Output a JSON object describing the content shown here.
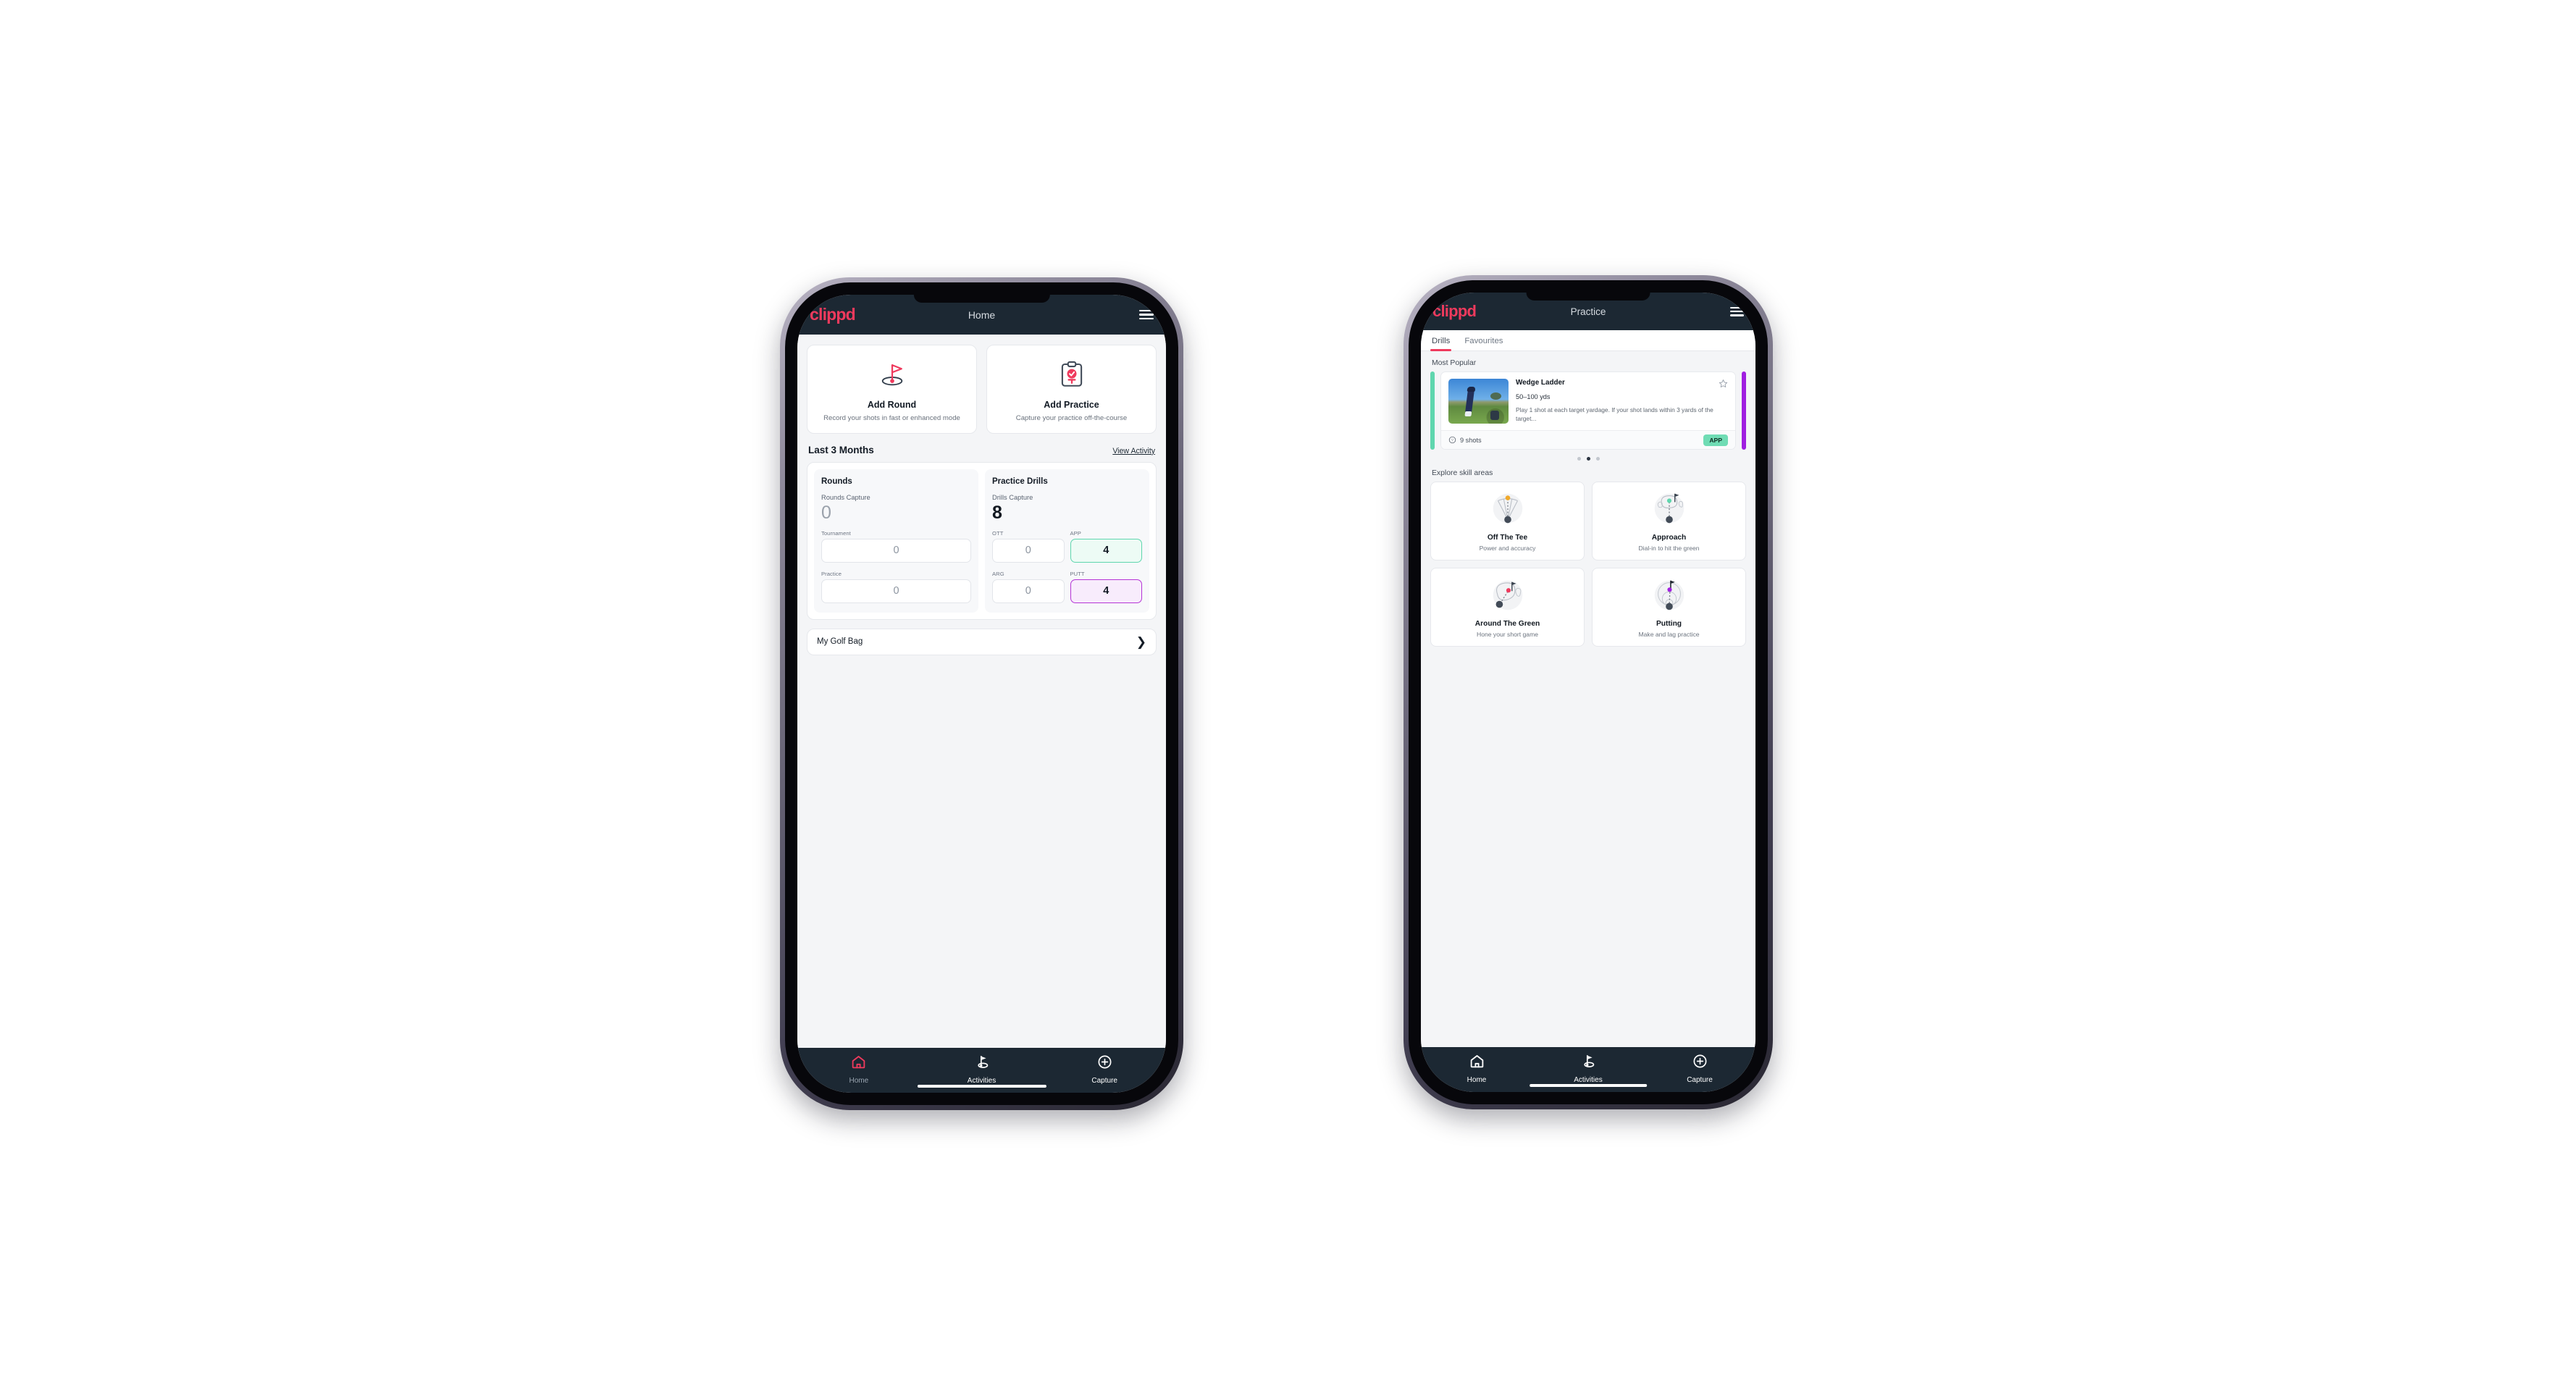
{
  "brand": {
    "logo_text": "clippd",
    "accent_pink": "#ef3a5d",
    "appbar_bg": "#1c2833",
    "mint": "#5fd6ae",
    "violet": "#a01fe0"
  },
  "home": {
    "appbar": {
      "title": "Home",
      "menu_icon": "hamburger-icon"
    },
    "quick_actions": [
      {
        "icon": "golf-flag-hole-icon",
        "title": "Add Round",
        "subtitle": "Record your shots in fast or enhanced mode"
      },
      {
        "icon": "clipboard-check-tee-icon",
        "title": "Add Practice",
        "subtitle": "Capture your practice off-the-course"
      }
    ],
    "section": {
      "title": "Last 3 Months",
      "link": "View Activity"
    },
    "rounds": {
      "heading": "Rounds",
      "capture_label": "Rounds Capture",
      "capture_value": "0",
      "items": [
        {
          "label": "Tournament",
          "value": "0",
          "state": "empty"
        },
        {
          "label": "Practice",
          "value": "0",
          "state": "empty"
        }
      ]
    },
    "drills": {
      "heading": "Practice Drills",
      "capture_label": "Drills Capture",
      "capture_value": "8",
      "items": [
        {
          "label": "OTT",
          "value": "0",
          "state": "empty"
        },
        {
          "label": "APP",
          "value": "4",
          "state": "app"
        },
        {
          "label": "ARG",
          "value": "0",
          "state": "empty"
        },
        {
          "label": "PUTT",
          "value": "4",
          "state": "putt"
        }
      ]
    },
    "golf_bag": {
      "label": "My Golf Bag",
      "chevron": "chevron-right-icon"
    },
    "bottom_nav": [
      {
        "label": "Home",
        "icon": "home-icon",
        "active": true
      },
      {
        "label": "Activities",
        "icon": "golf-flag-icon",
        "active": false
      },
      {
        "label": "Capture",
        "icon": "plus-circle-icon",
        "active": false
      }
    ]
  },
  "practice": {
    "appbar": {
      "title": "Practice",
      "menu_icon": "hamburger-icon"
    },
    "tabs": [
      {
        "label": "Drills",
        "active": true
      },
      {
        "label": "Favourites",
        "active": false
      }
    ],
    "most_popular_label": "Most Popular",
    "featured_drill": {
      "name": "Wedge Ladder",
      "yardage": "50–100 yds",
      "description": "Play 1 shot at each target yardage. If your shot lands within 3 yards of the target...",
      "shots": "9 shots",
      "shots_icon": "golf-ball-icon",
      "badge": "APP",
      "favourite_icon": "star-outline-icon",
      "thumbnail": "golfer-wedge-photo"
    },
    "carousel_dots": {
      "count": 3,
      "active_index": 1
    },
    "skill_header": "Explore skill areas",
    "skill_areas": [
      {
        "name": "Off The Tee",
        "subtitle": "Power and accuracy",
        "icon": "tee-fan-icon",
        "dot": "#f0a92b"
      },
      {
        "name": "Approach",
        "subtitle": "Dial-in to hit the green",
        "icon": "green-approach-icon",
        "dot": "#5fd6ae"
      },
      {
        "name": "Around The Green",
        "subtitle": "Hone your short game",
        "icon": "chip-green-icon",
        "dot": "#ef3a5d"
      },
      {
        "name": "Putting",
        "subtitle": "Make and lag practice",
        "icon": "putting-rings-icon",
        "dot": "#a01fe0"
      }
    ],
    "bottom_nav": [
      {
        "label": "Home",
        "icon": "home-icon",
        "active": true
      },
      {
        "label": "Activities",
        "icon": "golf-flag-icon",
        "active": false
      },
      {
        "label": "Capture",
        "icon": "plus-circle-icon",
        "active": false
      }
    ]
  }
}
